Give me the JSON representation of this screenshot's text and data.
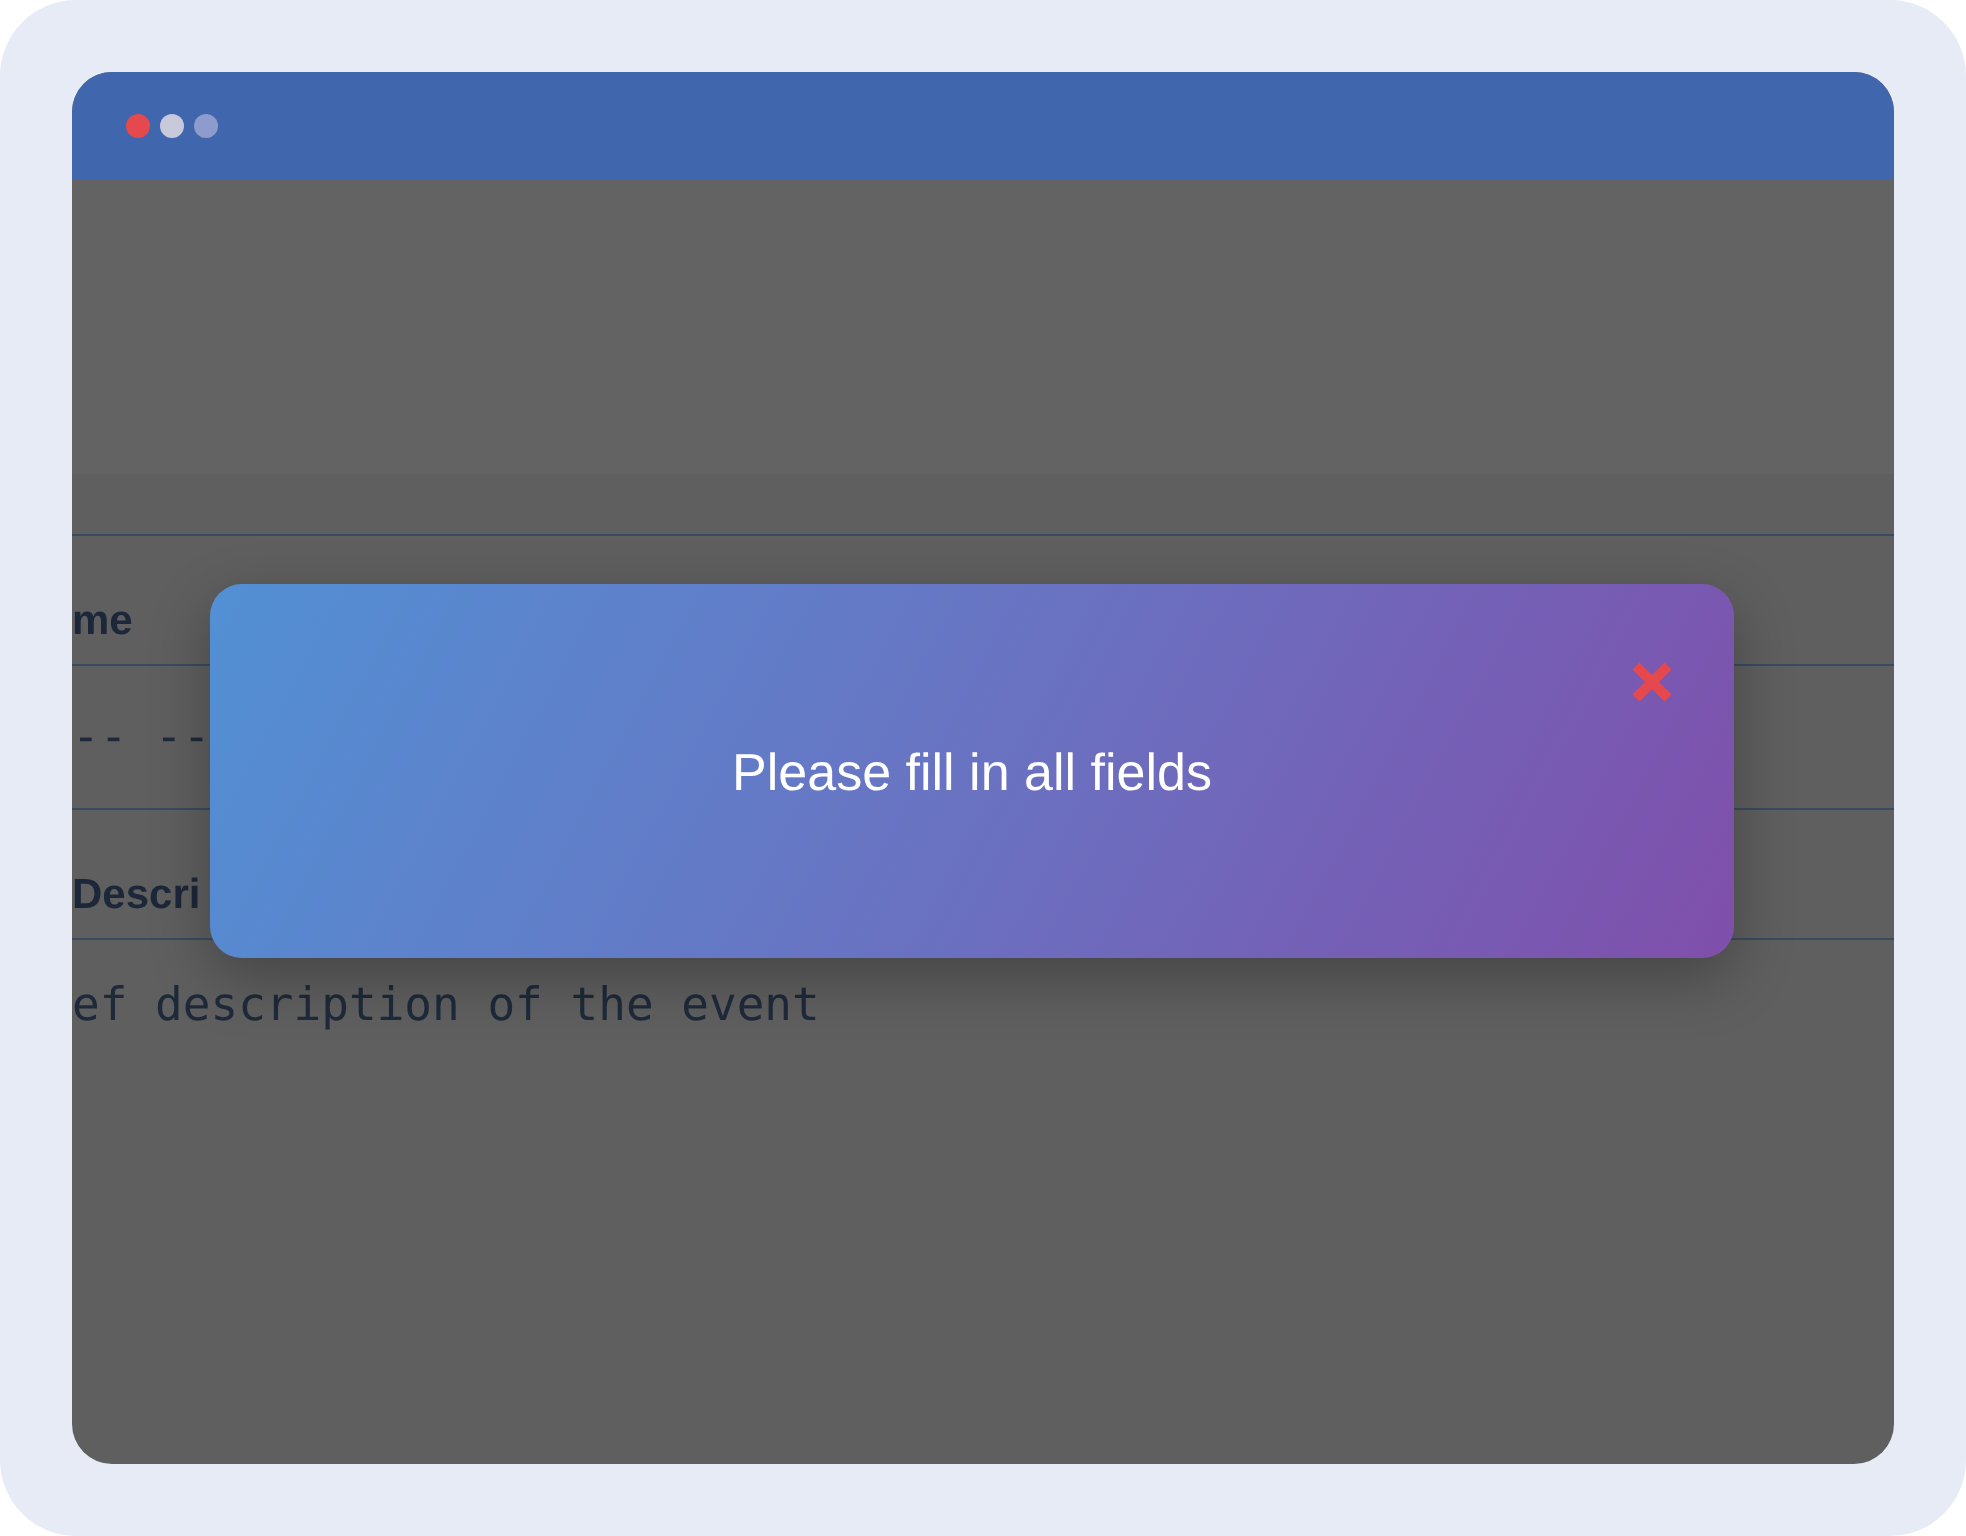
{
  "window": {
    "controls": [
      {
        "color": "#e5484d"
      },
      {
        "color": "#c9c9dc"
      },
      {
        "color": "#8d9ccd"
      }
    ]
  },
  "form": {
    "fields": [
      {
        "label": "me",
        "kind": "date",
        "value": "-- --"
      },
      {
        "label": "Descri",
        "kind": "textarea",
        "placeholder": "ef description of the event"
      }
    ]
  },
  "toast": {
    "message": "Please fill in all fields"
  }
}
